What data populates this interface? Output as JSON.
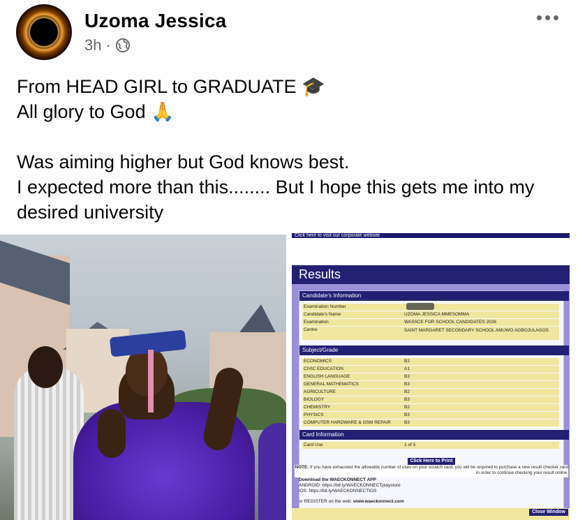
{
  "post": {
    "author": "Uzoma Jessica",
    "time": "3h",
    "separator": "·",
    "visibility_icon": "globe-icon",
    "more_icon": "more-dots-icon",
    "lines": [
      "From HEAD GIRL to GRADUATE 🎓",
      "All glory to God 🙏",
      "",
      "Was aiming higher but God knows best.",
      "I expected more than this........ But I hope this gets me into my desired university"
    ]
  },
  "result_sheet": {
    "top_link": "Click here to visit our corporate website",
    "title": "Results",
    "candidate_header": "Candidate's Information",
    "candidate": [
      {
        "label": "Examination Number",
        "value": ""
      },
      {
        "label": "Candidate's Name",
        "value": "UZOMA JESSICA MMESOMMA"
      },
      {
        "label": "Examination",
        "value": "WASSCE FOR SCHOOL CANDIDATES 2026"
      },
      {
        "label": "Centre",
        "value": "SAINT MARGARET SECONDARY SCHOOL AMUWO AGBOJULAGOS"
      }
    ],
    "grades_header": "Subject/Grade",
    "grades": [
      {
        "subject": "ECONOMICS",
        "grade": "B2"
      },
      {
        "subject": "CIVIC EDUCATION",
        "grade": "A1"
      },
      {
        "subject": "ENGLISH LANGUAGE",
        "grade": "B3"
      },
      {
        "subject": "GENERAL MATHEMATICS",
        "grade": "B3"
      },
      {
        "subject": "AGRICULTURE",
        "grade": "B2"
      },
      {
        "subject": "BIOLOGY",
        "grade": "B3"
      },
      {
        "subject": "CHEMISTRY",
        "grade": "B2"
      },
      {
        "subject": "PHYSICS",
        "grade": "B3"
      },
      {
        "subject": "COMPUTER HARDWARE & GSM REPAIR",
        "grade": "B3"
      }
    ],
    "card_header": "Card Information",
    "card": {
      "label": "Card Use",
      "value": "1 of 5"
    },
    "print_button": "Click Here to Print",
    "note_bold": "NOTE:",
    "note_text": "If you have exhausted the allowable number of uses on your scratch card, you will be required to purchase a new result checker card in order to continue checking your result online.",
    "app_title": "Download the WAECKONNECT APP",
    "android": "ANDROID: https://bit.ly/WAECKONNECTplaystore",
    "ios": "iOS: https://bit.ly/WAECKONNECTIOS",
    "web_prefix": "or REGISTER on the web: ",
    "web_url": "www.waeckonnect.com",
    "close_button": "Close Window"
  },
  "colors": {
    "author": "#050505",
    "meta": "#65676b",
    "waec_navy": "#232073",
    "waec_frame": "#9a8fd8",
    "waec_row": "#efe7a0"
  }
}
